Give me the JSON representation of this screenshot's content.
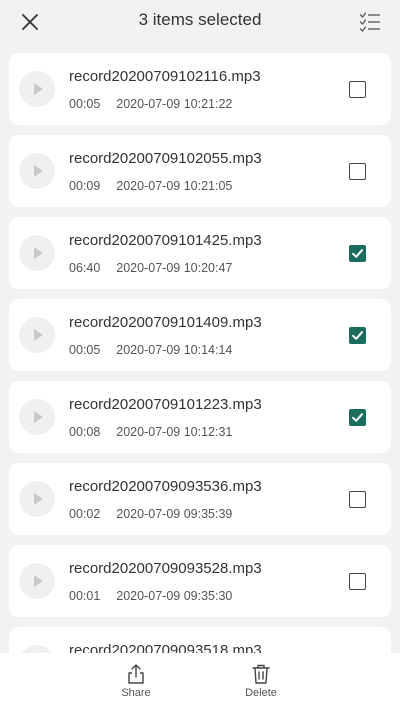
{
  "header": {
    "title": "3 items selected"
  },
  "recordings": [
    {
      "name": "record20200709102116.mp3",
      "duration": "00:05",
      "datetime": "2020-07-09 10:21:22",
      "checked": false
    },
    {
      "name": "record20200709102055.mp3",
      "duration": "00:09",
      "datetime": "2020-07-09 10:21:05",
      "checked": false
    },
    {
      "name": "record20200709101425.mp3",
      "duration": "06:40",
      "datetime": "2020-07-09 10:20:47",
      "checked": true
    },
    {
      "name": "record20200709101409.mp3",
      "duration": "00:05",
      "datetime": "2020-07-09 10:14:14",
      "checked": true
    },
    {
      "name": "record20200709101223.mp3",
      "duration": "00:08",
      "datetime": "2020-07-09 10:12:31",
      "checked": true
    },
    {
      "name": "record20200709093536.mp3",
      "duration": "00:02",
      "datetime": "2020-07-09 09:35:39",
      "checked": false
    },
    {
      "name": "record20200709093528.mp3",
      "duration": "00:01",
      "datetime": "2020-07-09 09:35:30",
      "checked": false
    },
    {
      "name": "record20200709093518.mp3",
      "duration": "",
      "datetime": "",
      "checked": false
    }
  ],
  "toolbar": {
    "share_label": "Share",
    "delete_label": "Delete"
  },
  "colors": {
    "accent": "#1b6e5e",
    "background": "#f2f2f2",
    "card": "#ffffff"
  },
  "icons": {
    "close": "close-icon",
    "select_all": "select-all-icon",
    "play": "play-icon",
    "share": "share-icon",
    "delete": "trash-icon"
  }
}
